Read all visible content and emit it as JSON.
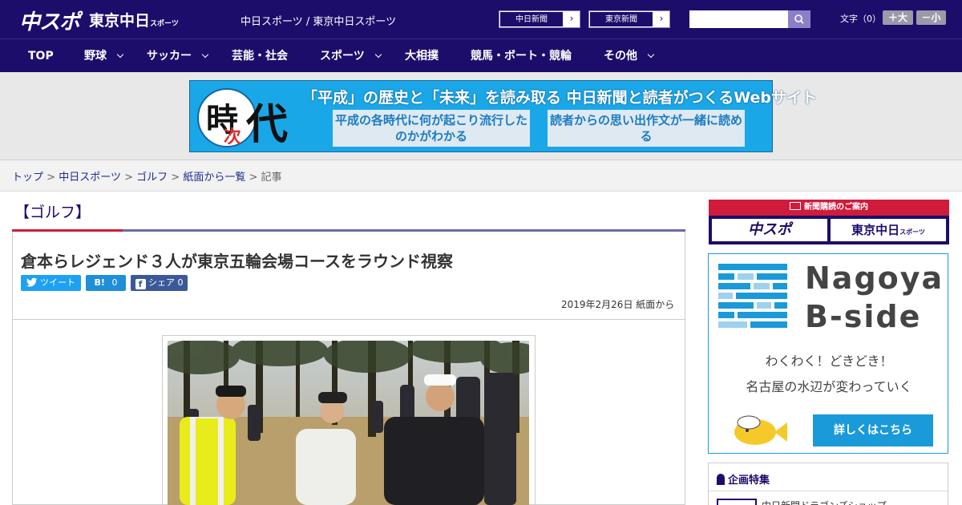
{
  "header": {
    "logo_chuspo": "中スポ",
    "logo_tokyo": "東京中日",
    "logo_tokyo_small": "スポーツ",
    "site_link": "中日スポーツ / 東京中日スポーツ",
    "paper_buttons": [
      "中日新聞",
      "東京新聞"
    ],
    "font_size_label": "文字（0）",
    "font_larger": "＋大",
    "font_smaller": "－小",
    "brand_color": "#1c0d6b"
  },
  "nav": {
    "items": [
      {
        "label": "TOP",
        "dropdown": false
      },
      {
        "label": "野球",
        "dropdown": true
      },
      {
        "label": "サッカー",
        "dropdown": true
      },
      {
        "label": "芸能・社会",
        "dropdown": false
      },
      {
        "label": "スポーツ",
        "dropdown": true
      },
      {
        "label": "大相撲",
        "dropdown": false
      },
      {
        "label": "競馬・ボート・競輪",
        "dropdown": false
      },
      {
        "label": "その他",
        "dropdown": true
      }
    ]
  },
  "banner": {
    "kanji1": "時",
    "kanji2": "次",
    "kanji3": "代",
    "headline": "「平成」の歴史と「未来」を読み取る 中日新聞と読者がつくるWebサイト",
    "box1": "平成の各時代に何が起こり流行したのかがわかる",
    "box2": "読者からの思い出作文が一緒に読める"
  },
  "breadcrumb": {
    "items": [
      "トップ",
      "中日スポーツ",
      "ゴルフ",
      "紙面から一覧"
    ],
    "current": "記事",
    "sep": ">"
  },
  "article": {
    "category": "【ゴルフ】",
    "title": "倉本らレジェンド３人が東京五輪会場コースをラウンド視察",
    "tweet_label": "ツイート",
    "hatena_label": "B!",
    "hatena_count": "0",
    "share_label": "シェア",
    "share_count": "0",
    "date": "2019年2月26日 紙面から"
  },
  "sidebar": {
    "subscribe_title": "新聞購読のご案内",
    "sub_logo1": "中スポ",
    "sub_logo2": "東京中日",
    "sub_logo2_small": "スポーツ",
    "bside_line1": "Nagoya",
    "bside_line2": "B-side",
    "bside_text1": "わくわく！どきどき！",
    "bside_text2": "名古屋の水辺が変わっていく",
    "bside_cta": "詳しくはこちら",
    "feature_title": "企画特集",
    "feature_item": "中日新聞ドラゴンズショップ"
  }
}
